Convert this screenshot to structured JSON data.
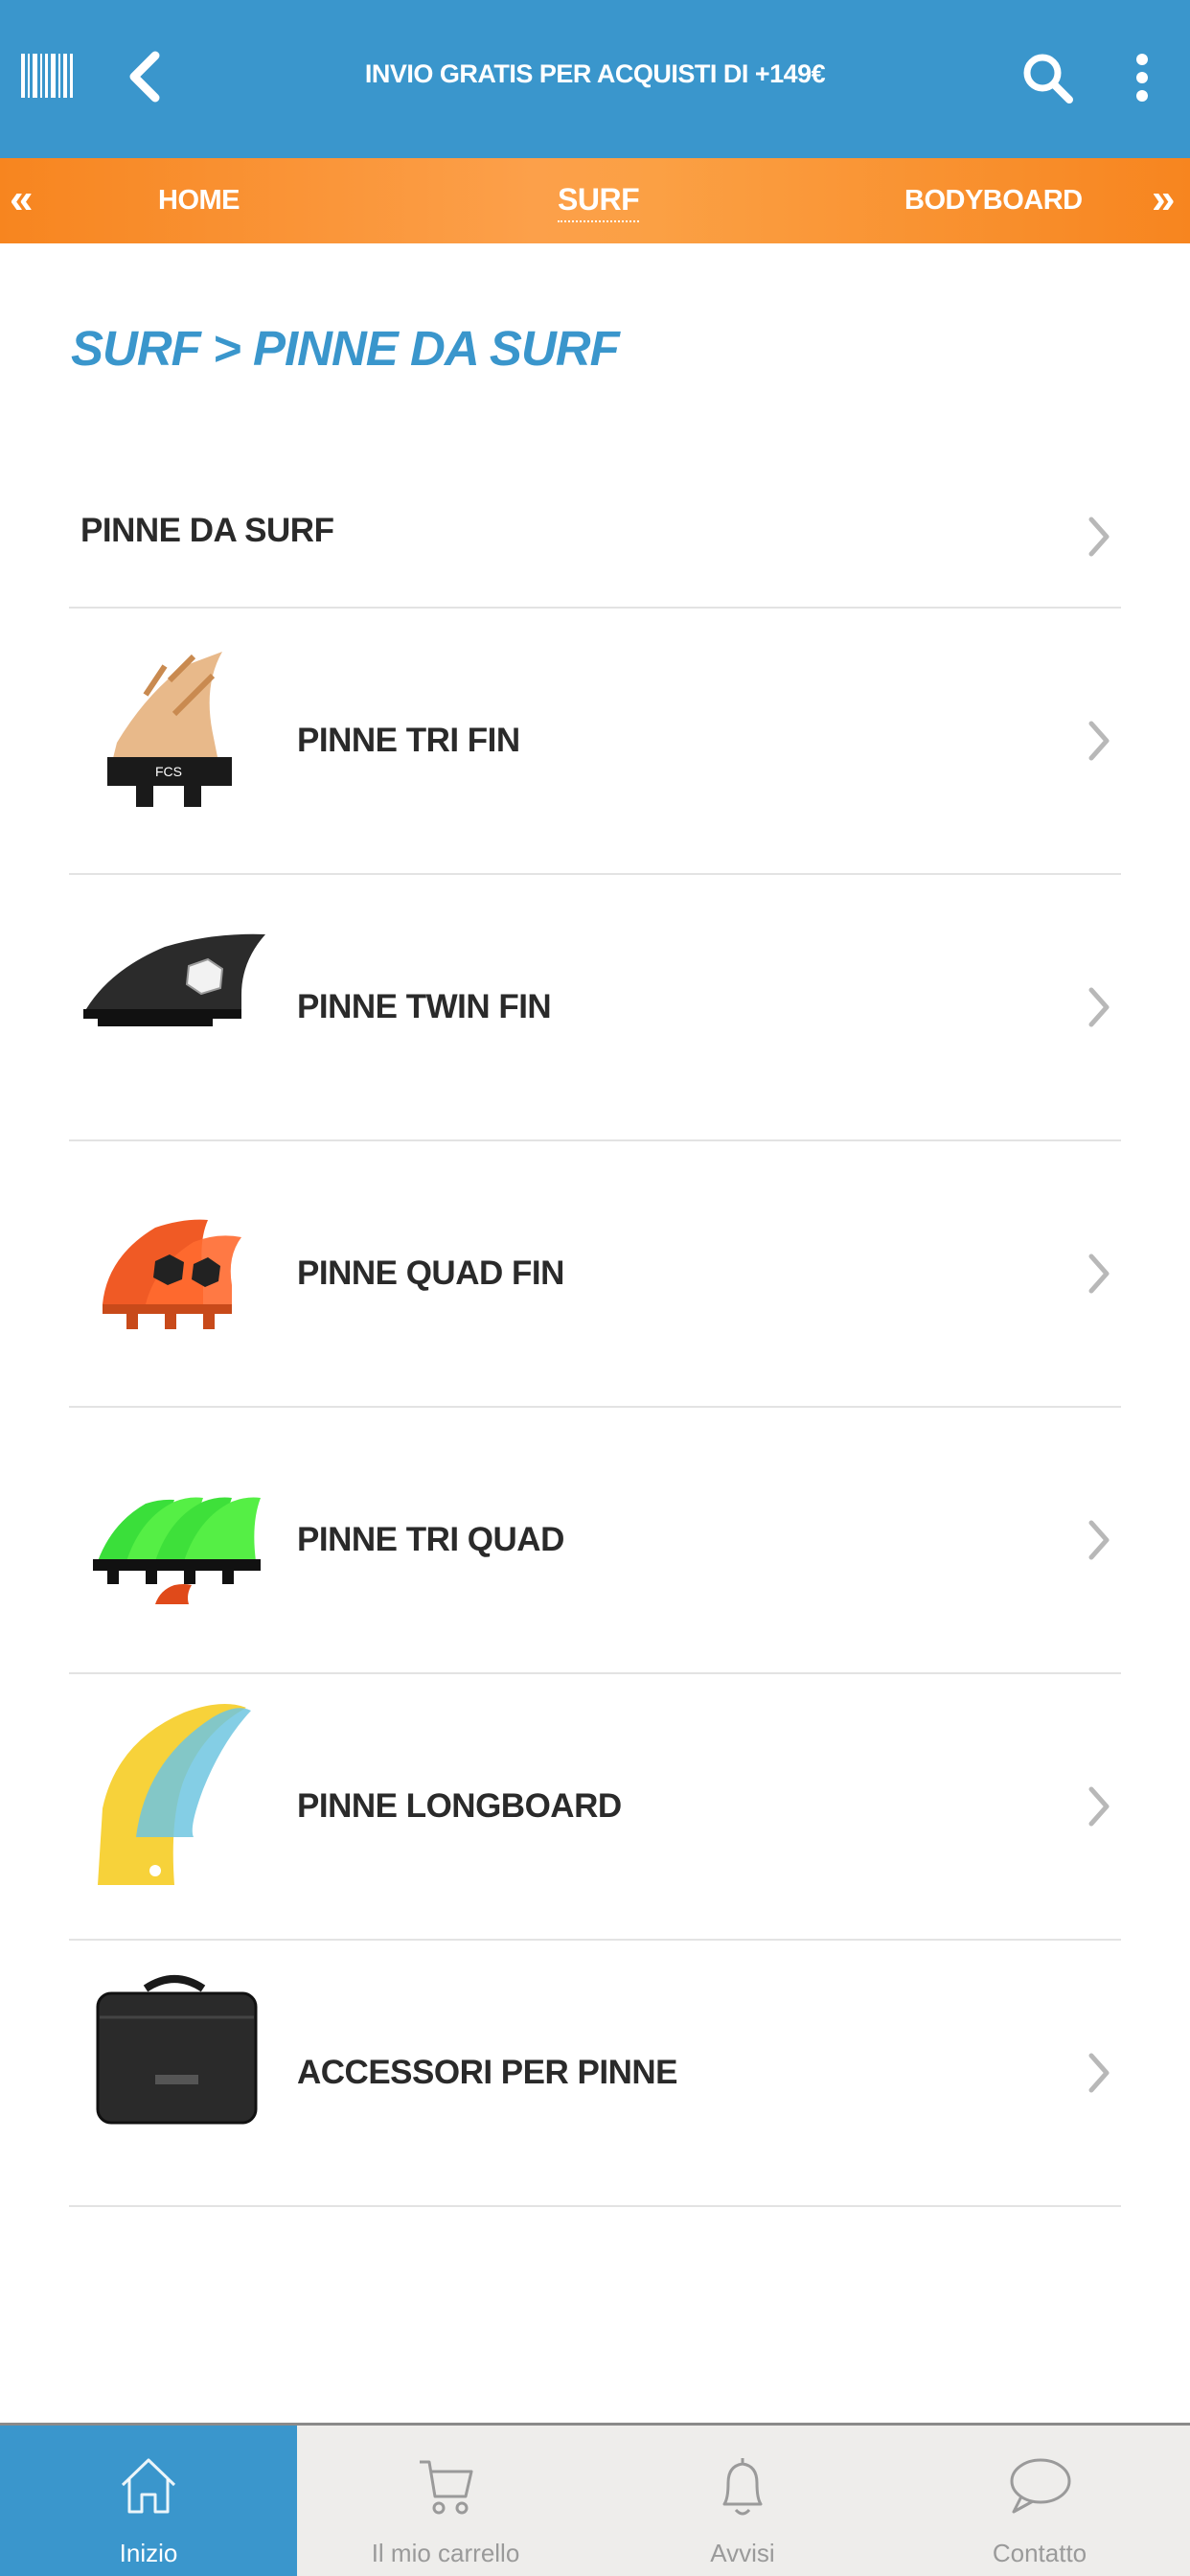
{
  "header": {
    "promo_text": "INVIO GRATIS PER ACQUISTI DI +149€",
    "icons": [
      "barcode-icon",
      "back-icon",
      "search-icon",
      "more-vertical-icon"
    ]
  },
  "category_nav": {
    "tabs": [
      "HOME",
      "SURF",
      "BODYBOARD"
    ],
    "active_tab": "SURF"
  },
  "breadcrumb": "SURF > PINNE DA SURF",
  "list": {
    "header_item": "PINNE DA SURF",
    "items": [
      {
        "label": "PINNE TRI FIN",
        "thumb": "tri-fin-thumbnail"
      },
      {
        "label": "PINNE TWIN FIN",
        "thumb": "twin-fin-thumbnail"
      },
      {
        "label": "PINNE QUAD FIN",
        "thumb": "quad-fin-thumbnail"
      },
      {
        "label": "PINNE TRI QUAD",
        "thumb": "tri-quad-thumbnail"
      },
      {
        "label": "PINNE LONGBOARD",
        "thumb": "longboard-fin-thumbnail"
      },
      {
        "label": "ACCESSORI PER PINNE",
        "thumb": "fin-bag-thumbnail"
      }
    ]
  },
  "bottom_nav": {
    "items": [
      {
        "label": "Inizio",
        "icon": "home-icon"
      },
      {
        "label": "Il mio carrello",
        "icon": "cart-icon"
      },
      {
        "label": "Avvisi",
        "icon": "bell-icon"
      },
      {
        "label": "Contatto",
        "icon": "chat-icon"
      }
    ],
    "active": "Inizio"
  },
  "colors": {
    "primary_blue": "#3a96cc",
    "accent_orange": "#f7851f",
    "text_dark": "#2a2a2a",
    "chevron_gray": "#b8b8b8",
    "bottom_bar_bg": "#eeedeb"
  }
}
